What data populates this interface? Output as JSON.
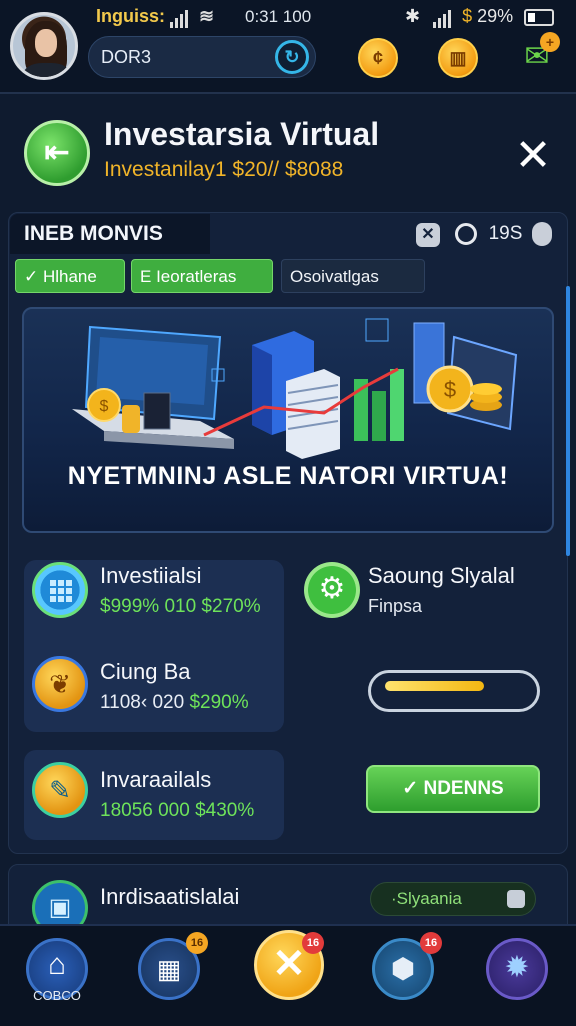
{
  "status_bar": {
    "left_text": "Inguiss:",
    "time": "0:31 100",
    "battery": "29%"
  },
  "header": {
    "username": "DOR3",
    "coin1_icon": "coin-icon",
    "coin2_icon": "coin-stack-icon",
    "gift_icon": "gift-icon"
  },
  "panel": {
    "title": "Investarsia Virtual",
    "subtitle": "Investanilay1 $20// $8088"
  },
  "section": {
    "title": "INEB MONVIS",
    "counter": "19S",
    "tabs": [
      "Hlhane",
      "Ieoratleras",
      "Osoivatlgas"
    ]
  },
  "banner": {
    "text": "NYETMNINJ ASLE NATORI VIRTUA!"
  },
  "rows": [
    {
      "title": "Investiialsi",
      "value_white": "$999%",
      "value_green": "010 $270%"
    },
    {
      "title": "Ciung Ba",
      "value_white": "1108‹ 020",
      "value_green": "$290%"
    },
    {
      "title": "Invaraailals",
      "value_white": "18056 000",
      "value_green": "$430%"
    },
    {
      "title": "Inrdisaatislalai"
    }
  ],
  "right_panel": {
    "title": "Saoung Slyalal",
    "subtitle": "Finpsa",
    "progress": 0.72,
    "button_label": "NDENNS",
    "pill_label": "·Slyaania"
  },
  "nav": {
    "home_label": "COBCO",
    "badges": [
      "16",
      "16",
      "16"
    ]
  },
  "colors": {
    "accent_green": "#3fae3f",
    "accent_gold": "#f0b429",
    "background": "#0b1526"
  }
}
